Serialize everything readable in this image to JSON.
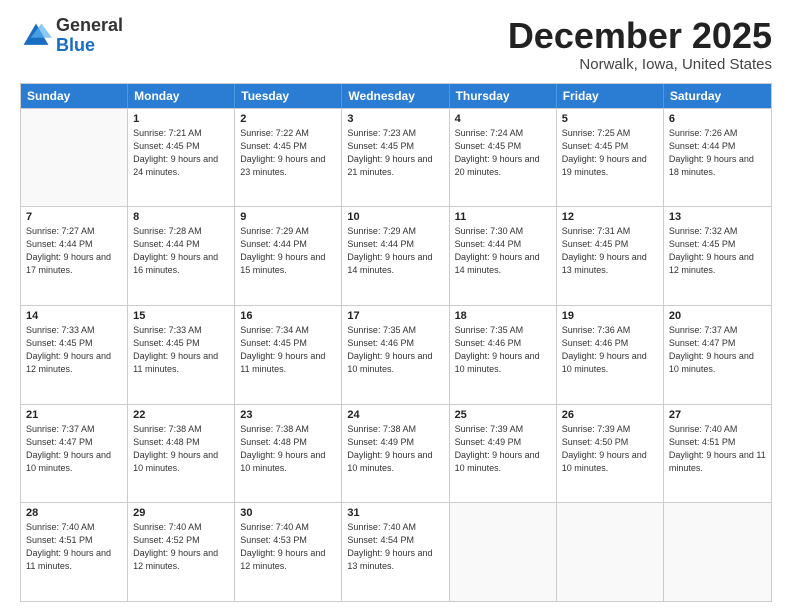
{
  "logo": {
    "general": "General",
    "blue": "Blue"
  },
  "header": {
    "month": "December 2025",
    "location": "Norwalk, Iowa, United States"
  },
  "days": [
    "Sunday",
    "Monday",
    "Tuesday",
    "Wednesday",
    "Thursday",
    "Friday",
    "Saturday"
  ],
  "weeks": [
    [
      {
        "day": "",
        "sunrise": "",
        "sunset": "",
        "daylight": ""
      },
      {
        "day": "1",
        "sunrise": "Sunrise: 7:21 AM",
        "sunset": "Sunset: 4:45 PM",
        "daylight": "Daylight: 9 hours and 24 minutes."
      },
      {
        "day": "2",
        "sunrise": "Sunrise: 7:22 AM",
        "sunset": "Sunset: 4:45 PM",
        "daylight": "Daylight: 9 hours and 23 minutes."
      },
      {
        "day": "3",
        "sunrise": "Sunrise: 7:23 AM",
        "sunset": "Sunset: 4:45 PM",
        "daylight": "Daylight: 9 hours and 21 minutes."
      },
      {
        "day": "4",
        "sunrise": "Sunrise: 7:24 AM",
        "sunset": "Sunset: 4:45 PM",
        "daylight": "Daylight: 9 hours and 20 minutes."
      },
      {
        "day": "5",
        "sunrise": "Sunrise: 7:25 AM",
        "sunset": "Sunset: 4:45 PM",
        "daylight": "Daylight: 9 hours and 19 minutes."
      },
      {
        "day": "6",
        "sunrise": "Sunrise: 7:26 AM",
        "sunset": "Sunset: 4:44 PM",
        "daylight": "Daylight: 9 hours and 18 minutes."
      }
    ],
    [
      {
        "day": "7",
        "sunrise": "Sunrise: 7:27 AM",
        "sunset": "Sunset: 4:44 PM",
        "daylight": "Daylight: 9 hours and 17 minutes."
      },
      {
        "day": "8",
        "sunrise": "Sunrise: 7:28 AM",
        "sunset": "Sunset: 4:44 PM",
        "daylight": "Daylight: 9 hours and 16 minutes."
      },
      {
        "day": "9",
        "sunrise": "Sunrise: 7:29 AM",
        "sunset": "Sunset: 4:44 PM",
        "daylight": "Daylight: 9 hours and 15 minutes."
      },
      {
        "day": "10",
        "sunrise": "Sunrise: 7:29 AM",
        "sunset": "Sunset: 4:44 PM",
        "daylight": "Daylight: 9 hours and 14 minutes."
      },
      {
        "day": "11",
        "sunrise": "Sunrise: 7:30 AM",
        "sunset": "Sunset: 4:44 PM",
        "daylight": "Daylight: 9 hours and 14 minutes."
      },
      {
        "day": "12",
        "sunrise": "Sunrise: 7:31 AM",
        "sunset": "Sunset: 4:45 PM",
        "daylight": "Daylight: 9 hours and 13 minutes."
      },
      {
        "day": "13",
        "sunrise": "Sunrise: 7:32 AM",
        "sunset": "Sunset: 4:45 PM",
        "daylight": "Daylight: 9 hours and 12 minutes."
      }
    ],
    [
      {
        "day": "14",
        "sunrise": "Sunrise: 7:33 AM",
        "sunset": "Sunset: 4:45 PM",
        "daylight": "Daylight: 9 hours and 12 minutes."
      },
      {
        "day": "15",
        "sunrise": "Sunrise: 7:33 AM",
        "sunset": "Sunset: 4:45 PM",
        "daylight": "Daylight: 9 hours and 11 minutes."
      },
      {
        "day": "16",
        "sunrise": "Sunrise: 7:34 AM",
        "sunset": "Sunset: 4:45 PM",
        "daylight": "Daylight: 9 hours and 11 minutes."
      },
      {
        "day": "17",
        "sunrise": "Sunrise: 7:35 AM",
        "sunset": "Sunset: 4:46 PM",
        "daylight": "Daylight: 9 hours and 10 minutes."
      },
      {
        "day": "18",
        "sunrise": "Sunrise: 7:35 AM",
        "sunset": "Sunset: 4:46 PM",
        "daylight": "Daylight: 9 hours and 10 minutes."
      },
      {
        "day": "19",
        "sunrise": "Sunrise: 7:36 AM",
        "sunset": "Sunset: 4:46 PM",
        "daylight": "Daylight: 9 hours and 10 minutes."
      },
      {
        "day": "20",
        "sunrise": "Sunrise: 7:37 AM",
        "sunset": "Sunset: 4:47 PM",
        "daylight": "Daylight: 9 hours and 10 minutes."
      }
    ],
    [
      {
        "day": "21",
        "sunrise": "Sunrise: 7:37 AM",
        "sunset": "Sunset: 4:47 PM",
        "daylight": "Daylight: 9 hours and 10 minutes."
      },
      {
        "day": "22",
        "sunrise": "Sunrise: 7:38 AM",
        "sunset": "Sunset: 4:48 PM",
        "daylight": "Daylight: 9 hours and 10 minutes."
      },
      {
        "day": "23",
        "sunrise": "Sunrise: 7:38 AM",
        "sunset": "Sunset: 4:48 PM",
        "daylight": "Daylight: 9 hours and 10 minutes."
      },
      {
        "day": "24",
        "sunrise": "Sunrise: 7:38 AM",
        "sunset": "Sunset: 4:49 PM",
        "daylight": "Daylight: 9 hours and 10 minutes."
      },
      {
        "day": "25",
        "sunrise": "Sunrise: 7:39 AM",
        "sunset": "Sunset: 4:49 PM",
        "daylight": "Daylight: 9 hours and 10 minutes."
      },
      {
        "day": "26",
        "sunrise": "Sunrise: 7:39 AM",
        "sunset": "Sunset: 4:50 PM",
        "daylight": "Daylight: 9 hours and 10 minutes."
      },
      {
        "day": "27",
        "sunrise": "Sunrise: 7:40 AM",
        "sunset": "Sunset: 4:51 PM",
        "daylight": "Daylight: 9 hours and 11 minutes."
      }
    ],
    [
      {
        "day": "28",
        "sunrise": "Sunrise: 7:40 AM",
        "sunset": "Sunset: 4:51 PM",
        "daylight": "Daylight: 9 hours and 11 minutes."
      },
      {
        "day": "29",
        "sunrise": "Sunrise: 7:40 AM",
        "sunset": "Sunset: 4:52 PM",
        "daylight": "Daylight: 9 hours and 12 minutes."
      },
      {
        "day": "30",
        "sunrise": "Sunrise: 7:40 AM",
        "sunset": "Sunset: 4:53 PM",
        "daylight": "Daylight: 9 hours and 12 minutes."
      },
      {
        "day": "31",
        "sunrise": "Sunrise: 7:40 AM",
        "sunset": "Sunset: 4:54 PM",
        "daylight": "Daylight: 9 hours and 13 minutes."
      },
      {
        "day": "",
        "sunrise": "",
        "sunset": "",
        "daylight": ""
      },
      {
        "day": "",
        "sunrise": "",
        "sunset": "",
        "daylight": ""
      },
      {
        "day": "",
        "sunrise": "",
        "sunset": "",
        "daylight": ""
      }
    ]
  ]
}
